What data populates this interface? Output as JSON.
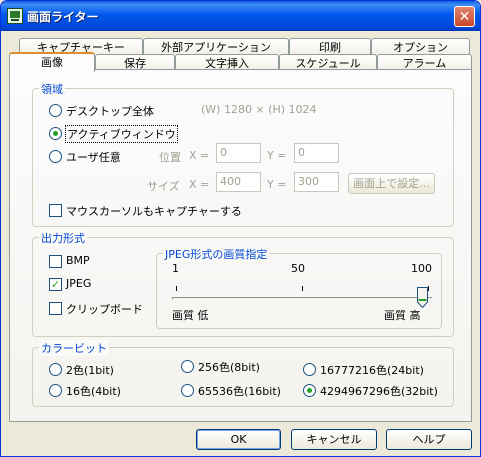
{
  "window": {
    "title": "画面ライター"
  },
  "tabs_back": [
    "キャプチャーキー",
    "外部アプリケーション",
    "印刷",
    "オプション"
  ],
  "tabs_front": [
    "画像",
    "保存",
    "文字挿入",
    "スケジュール",
    "アラーム"
  ],
  "region": {
    "title": "領域",
    "desktop": "デスクトップ全体",
    "resolution": "(W) 1280 × (H) 1024",
    "active_window": "アクティブウィンドウ",
    "custom": "ユーザ任意",
    "position_label": "位置",
    "x_label": "X =",
    "y_label": "Y =",
    "pos_x": "0",
    "pos_y": "0",
    "size_label": "サイズ",
    "size_w": "400",
    "size_h": "300",
    "set_on_screen": "画面上で設定...",
    "mouse_cursor": "マウスカーソルもキャプチャーする"
  },
  "output": {
    "title": "出力形式",
    "bmp": "BMP",
    "jpeg": "JPEG",
    "clipboard": "クリップボード",
    "jpeg_quality": {
      "title": "JPEG形式の画質指定",
      "min": "1",
      "mid": "50",
      "max": "100",
      "low": "画質 低",
      "high": "画質 高",
      "value": 100
    }
  },
  "color_bits": {
    "title": "カラービット",
    "options": [
      "2色(1bit)",
      "256色(8bit)",
      "16777216色(24bit)",
      "16色(4bit)",
      "65536色(16bit)",
      "4294967296色(32bit)"
    ],
    "selected": "4294967296色(32bit)"
  },
  "buttons": {
    "ok": "OK",
    "cancel": "キャンセル",
    "help": "ヘルプ"
  }
}
